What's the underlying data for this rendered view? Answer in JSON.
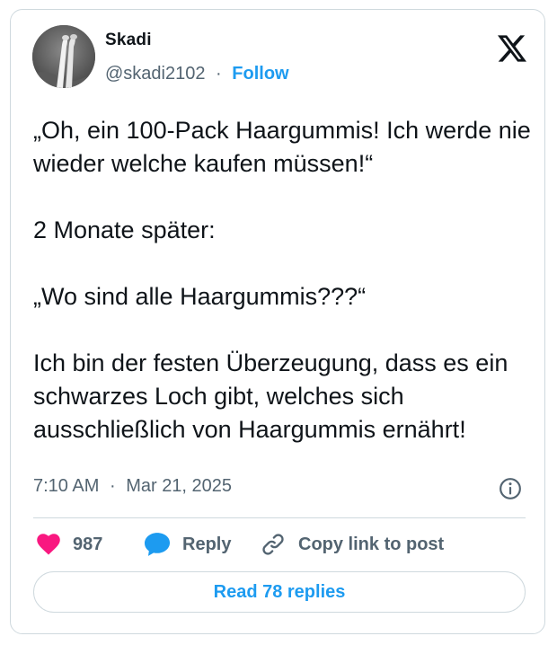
{
  "tweet": {
    "author_name": "Skadi",
    "handle": "@skadi2102",
    "separator": "·",
    "follow_label": "Follow",
    "text": "„Oh, ein 100-Pack Haargummis! Ich werde nie wieder welche kaufen müssen!“\n\n2 Monate später:\n\n„Wo sind alle Haargummis???“\n\nIch bin der festen Überzeugung, dass es ein schwarzes Loch gibt, welches sich ausschließlich von Haargummis ernährt!",
    "time": "7:10 AM",
    "date": "Mar 21, 2025"
  },
  "actions": {
    "like_count": "987",
    "reply_label": "Reply",
    "copy_link_label": "Copy link to post"
  },
  "footer": {
    "read_replies_label": "Read 78 replies"
  },
  "icons": {
    "logo": "x-logo-icon",
    "info": "info-icon",
    "like": "heart-icon",
    "reply": "speech-bubble-icon",
    "copy": "link-icon"
  },
  "colors": {
    "accent": "#1d9bf0",
    "heart": "#f91880",
    "muted": "#536471",
    "text": "#0f1419",
    "border": "#cfd9de"
  }
}
